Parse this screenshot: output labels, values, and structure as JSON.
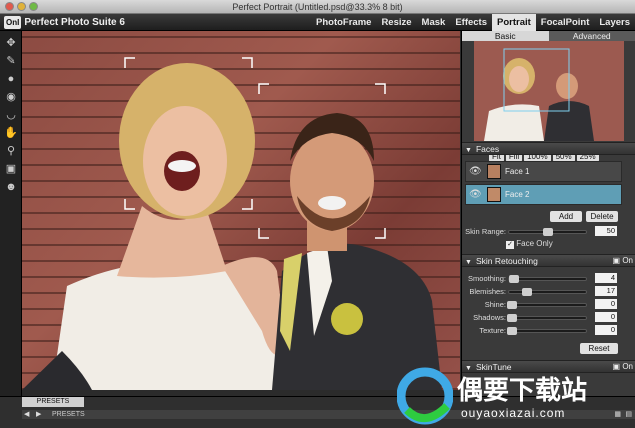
{
  "window": {
    "title": "Perfect Portrait (Untitled.psd@33.3% 8 bit)"
  },
  "app": {
    "logo_badge": "OnI",
    "name": "Perfect Photo Suite 6"
  },
  "modules": [
    "PhotoFrame",
    "Resize",
    "Mask",
    "Effects",
    "Portrait",
    "FocalPoint",
    "Layers"
  ],
  "active_module": "Portrait",
  "tools": [
    "move-tool-icon",
    "brush-icon",
    "person-icon",
    "eye-icon",
    "lips-icon",
    "hand-icon",
    "zoom-icon",
    "compare-icon",
    "people-icon"
  ],
  "panel": {
    "tabs": {
      "basic": "Basic",
      "advanced": "Advanced"
    },
    "zoom_buttons": [
      "Fit",
      "Fill",
      "100%",
      "50%",
      "25%"
    ],
    "faces": {
      "title": "Faces",
      "items": [
        "Face 1",
        "Face 2"
      ],
      "add": "Add",
      "delete": "Delete",
      "skin_range_label": "Skin Range:",
      "skin_range_value": "50",
      "face_only_label": "Face Only"
    },
    "skin_retouching": {
      "title": "Skin Retouching",
      "on_label": "On",
      "sliders": [
        {
          "label": "Smoothing:",
          "value": "4"
        },
        {
          "label": "Blemishes:",
          "value": "17"
        },
        {
          "label": "Shine:",
          "value": "0"
        },
        {
          "label": "Shadows:",
          "value": "0"
        },
        {
          "label": "Texture:",
          "value": "0"
        }
      ],
      "reset": "Reset"
    },
    "skintune": {
      "title": "SkinTune",
      "on_label": "On"
    }
  },
  "bottom": {
    "presets_button": "PRESETS",
    "presets_label": "PRESETS"
  },
  "watermark": {
    "cn": "偶要下载站",
    "url": "ouyaoxiazai.com"
  },
  "colors": {
    "accent": "#5f9eb5",
    "panel_bg": "#3a3a3a",
    "brick": "#8c4b42"
  }
}
